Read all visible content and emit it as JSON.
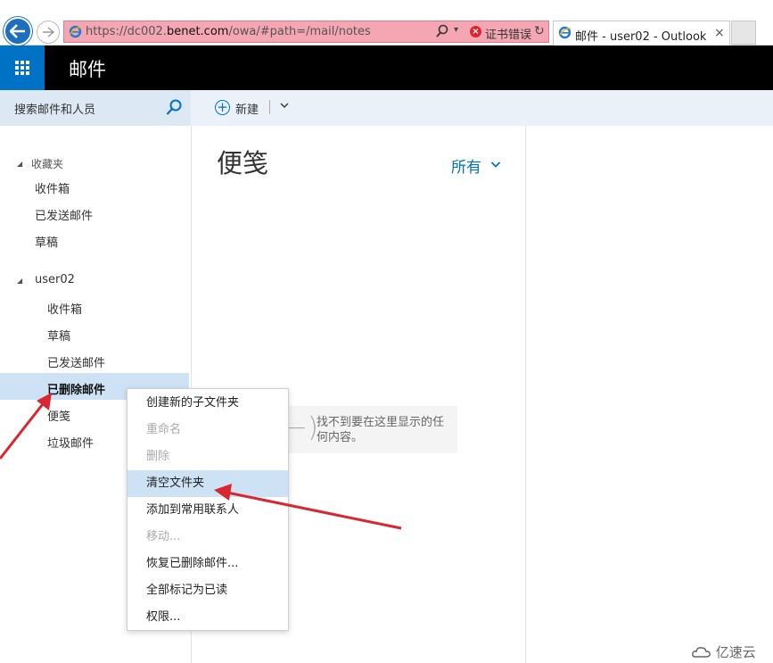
{
  "browser": {
    "url_prefix": "https://dc002.",
    "url_host": "benet.com",
    "url_suffix": "/owa/#path=/mail/notes",
    "cert_error": "证书错误",
    "tab_title": "邮件 - user02 - Outlook",
    "tab_close": "×"
  },
  "header": {
    "app_title": "邮件"
  },
  "commandbar": {
    "search_placeholder": "搜索邮件和人员",
    "new_label": "新建"
  },
  "folders": {
    "favorites": {
      "label": "收藏夹",
      "items": [
        "收件箱",
        "已发送邮件",
        "草稿"
      ]
    },
    "mailbox": {
      "label": "user02",
      "items": [
        "收件箱",
        "草稿",
        "已发送邮件",
        "已删除邮件",
        "便笺",
        "垃圾邮件"
      ]
    }
  },
  "notes": {
    "title": "便笺",
    "filter": "所有",
    "empty_message": "找不到要在这里显示的任何内容。"
  },
  "context_menu": {
    "items": [
      {
        "label": "创建新的子文件夹",
        "enabled": true
      },
      {
        "label": "重命名",
        "enabled": false
      },
      {
        "label": "删除",
        "enabled": false
      },
      {
        "label": "清空文件夹",
        "enabled": true,
        "highlighted": true
      },
      {
        "label": "添加到常用联系人",
        "enabled": true
      },
      {
        "label": "移动...",
        "enabled": false
      },
      {
        "label": "恢复已删除邮件...",
        "enabled": true
      },
      {
        "label": "全部标记为已读",
        "enabled": true
      },
      {
        "label": "权限...",
        "enabled": true
      }
    ]
  },
  "watermark": "亿速云",
  "colors": {
    "accent": "#0072c6",
    "annotation_arrow": "#d9262f",
    "selection": "#cde3f5"
  }
}
